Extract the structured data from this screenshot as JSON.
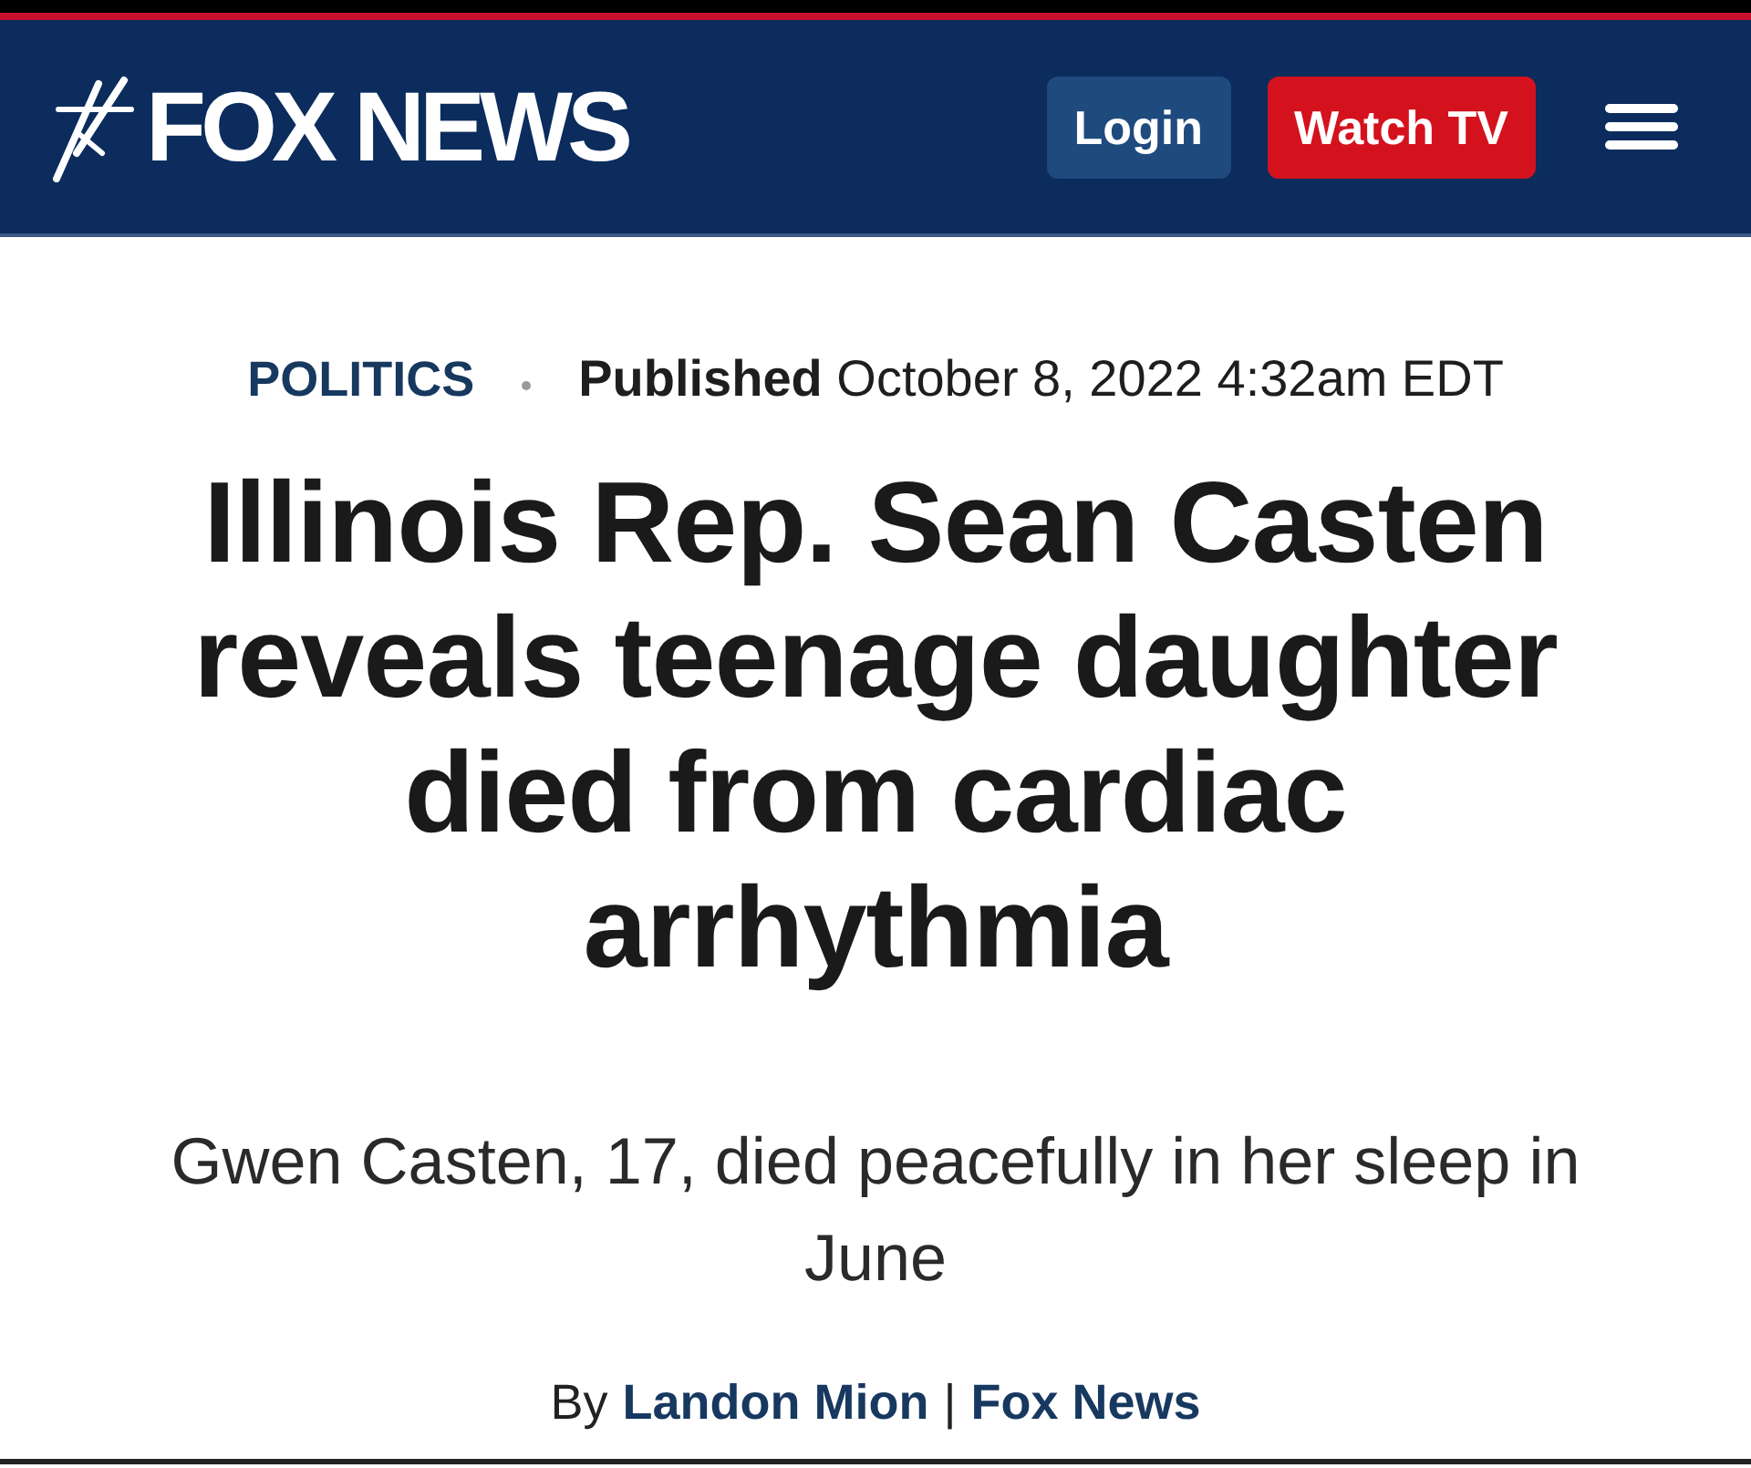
{
  "header": {
    "logo_text": "FOX NEWS",
    "buttons": [
      {
        "label": "Login",
        "kind": "secondary"
      },
      {
        "label": "Watch TV",
        "kind": "primary"
      }
    ]
  },
  "article": {
    "category": "POLITICS",
    "published": "**Published** October 8, 2022 4:32am EDT",
    "headline": "Illinois Rep. Sean Casten reveals teenage daughter died from cardiac arrhythmia",
    "subheadline": "Gwen Casten, 17, died peacefully in her sleep in June",
    "byline": {
      "prefix": "By",
      "author": "Landon Mion",
      "separator": "|",
      "source": "Fox News"
    }
  }
}
